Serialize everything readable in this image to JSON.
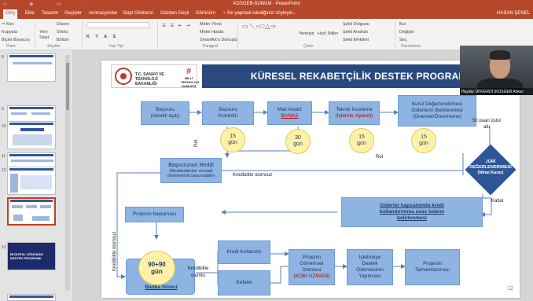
{
  "window": {
    "title": "KDSGEB-SUNUM - PowerPoint",
    "user": "HASAN ŞENEL"
  },
  "tabs": [
    "Giriş",
    "Ekle",
    "Tasarım",
    "Geçişler",
    "Animasyonlar",
    "Slayt Gösterisi",
    "Gözden Geçir",
    "Görünüm",
    "♀ Ne yapmak istediğinizi söyleyin..."
  ],
  "ribbon": {
    "clipboard": {
      "paste": "Yapıştır",
      "copy": "Kopyala",
      "painter": "Biçim Boyacısı",
      "label": "Pano"
    },
    "slides": {
      "new": "Yeni Slayt",
      "layout": "Düzen",
      "reset": "Sıfırla",
      "section": "Bölüm",
      "label": "Slaytlar"
    },
    "font": {
      "label": "Yazı Tipi"
    },
    "paragraph": {
      "dir": "Metin Yönü",
      "align": "Metni Hizala",
      "smartart": "SmartArt'a Dönüştür",
      "label": "Paragraf"
    },
    "drawing": {
      "arrange": "Yerleştir",
      "styles": "Hızlı Stiller",
      "fill": "Şekil Dolgusu",
      "outline": "Şekil Anahatı",
      "effects": "Şekil Efektleri",
      "label": "Çizim"
    },
    "editing": {
      "find": "Bul",
      "replace": "Değiştir",
      "select": "Seç",
      "label": "Düzenleme"
    }
  },
  "thumbnails": {
    "numbers": [
      "8",
      "9",
      "10",
      "11",
      "12",
      "13"
    ],
    "dark_text": "Bİ DİJİTAL DÖNÜŞÜM DESTEK PROGRAMI"
  },
  "camera": {
    "name": "Haydar ÜNVERDİ (KOSGEB Ankar"
  },
  "slide": {
    "ministry": "T.C. SANAYİ VE TEKNOLOJİ BAKANLIĞI",
    "mm_logo": "MİLLİ TEKNOLOJİ HAMLESİ",
    "title": "KÜRESEL REKABETÇİLİK DESTEK PROGRAMI",
    "boxes": {
      "basvuru": [
        "Başvuru",
        "(sürekli açık)"
      ],
      "kontrol": [
        "Başvuru",
        "Kontrolü"
      ],
      "mali": [
        "Mali Analiz",
        "BANKA"
      ],
      "teknik": [
        "Teknik İnceleme",
        "(İşletme ziyareti)"
      ],
      "kurul": [
        "Kurul Değerlendirmesi",
        "Giderlerin Belirlenmesi",
        "(Önerme/Önermeme)"
      ],
      "red": [
        "Başvurunun Reddi",
        "(Reddedilenler sonraki",
        "dönemlerde başvurabilir)"
      ],
      "giderler": [
        "Giderler kapsamında kredi",
        "kullandırımına esas tutarın",
        "belirlenmesi"
      ],
      "baslama": "Projenin başlaması",
      "kredi": "Kredi Kullanımı",
      "kefalet": "Kefalet",
      "izleme": [
        "Projenin",
        "Dönemsel",
        "İzlemesi",
        "(KOBİ UZMANI)"
      ],
      "odeme": [
        "İşletmeye",
        "Destek",
        "Ödemesinin",
        "Yapılması"
      ],
      "tamamlanma": [
        "Projenin",
        "Tamamlanması"
      ]
    },
    "circles": {
      "c1": [
        "15",
        "gün"
      ],
      "c2": [
        "30",
        "gün"
      ],
      "c3": [
        "15",
        "gün"
      ],
      "c4": [
        "15",
        "gün"
      ],
      "big": [
        "90+90",
        "gün"
      ]
    },
    "jury": [
      "JÜRİ",
      "DEĞERLENDİRMESİ",
      "(Nihai Karar)"
    ],
    "banka_sureci": "Banka Süreci",
    "labels": {
      "ret1": "Ret",
      "kredibilite_olumsuz": "Kredibilite olumsuz",
      "ret2": "Ret",
      "puan": "50 puan üstü/",
      "alti": "altı",
      "kabul": "Kabul",
      "kredibilite_olumsuz_v": "Kredibilite olumsuz",
      "kredibilite": "Kredibilite",
      "olumlu": "olumlu"
    },
    "page_number": "12"
  }
}
